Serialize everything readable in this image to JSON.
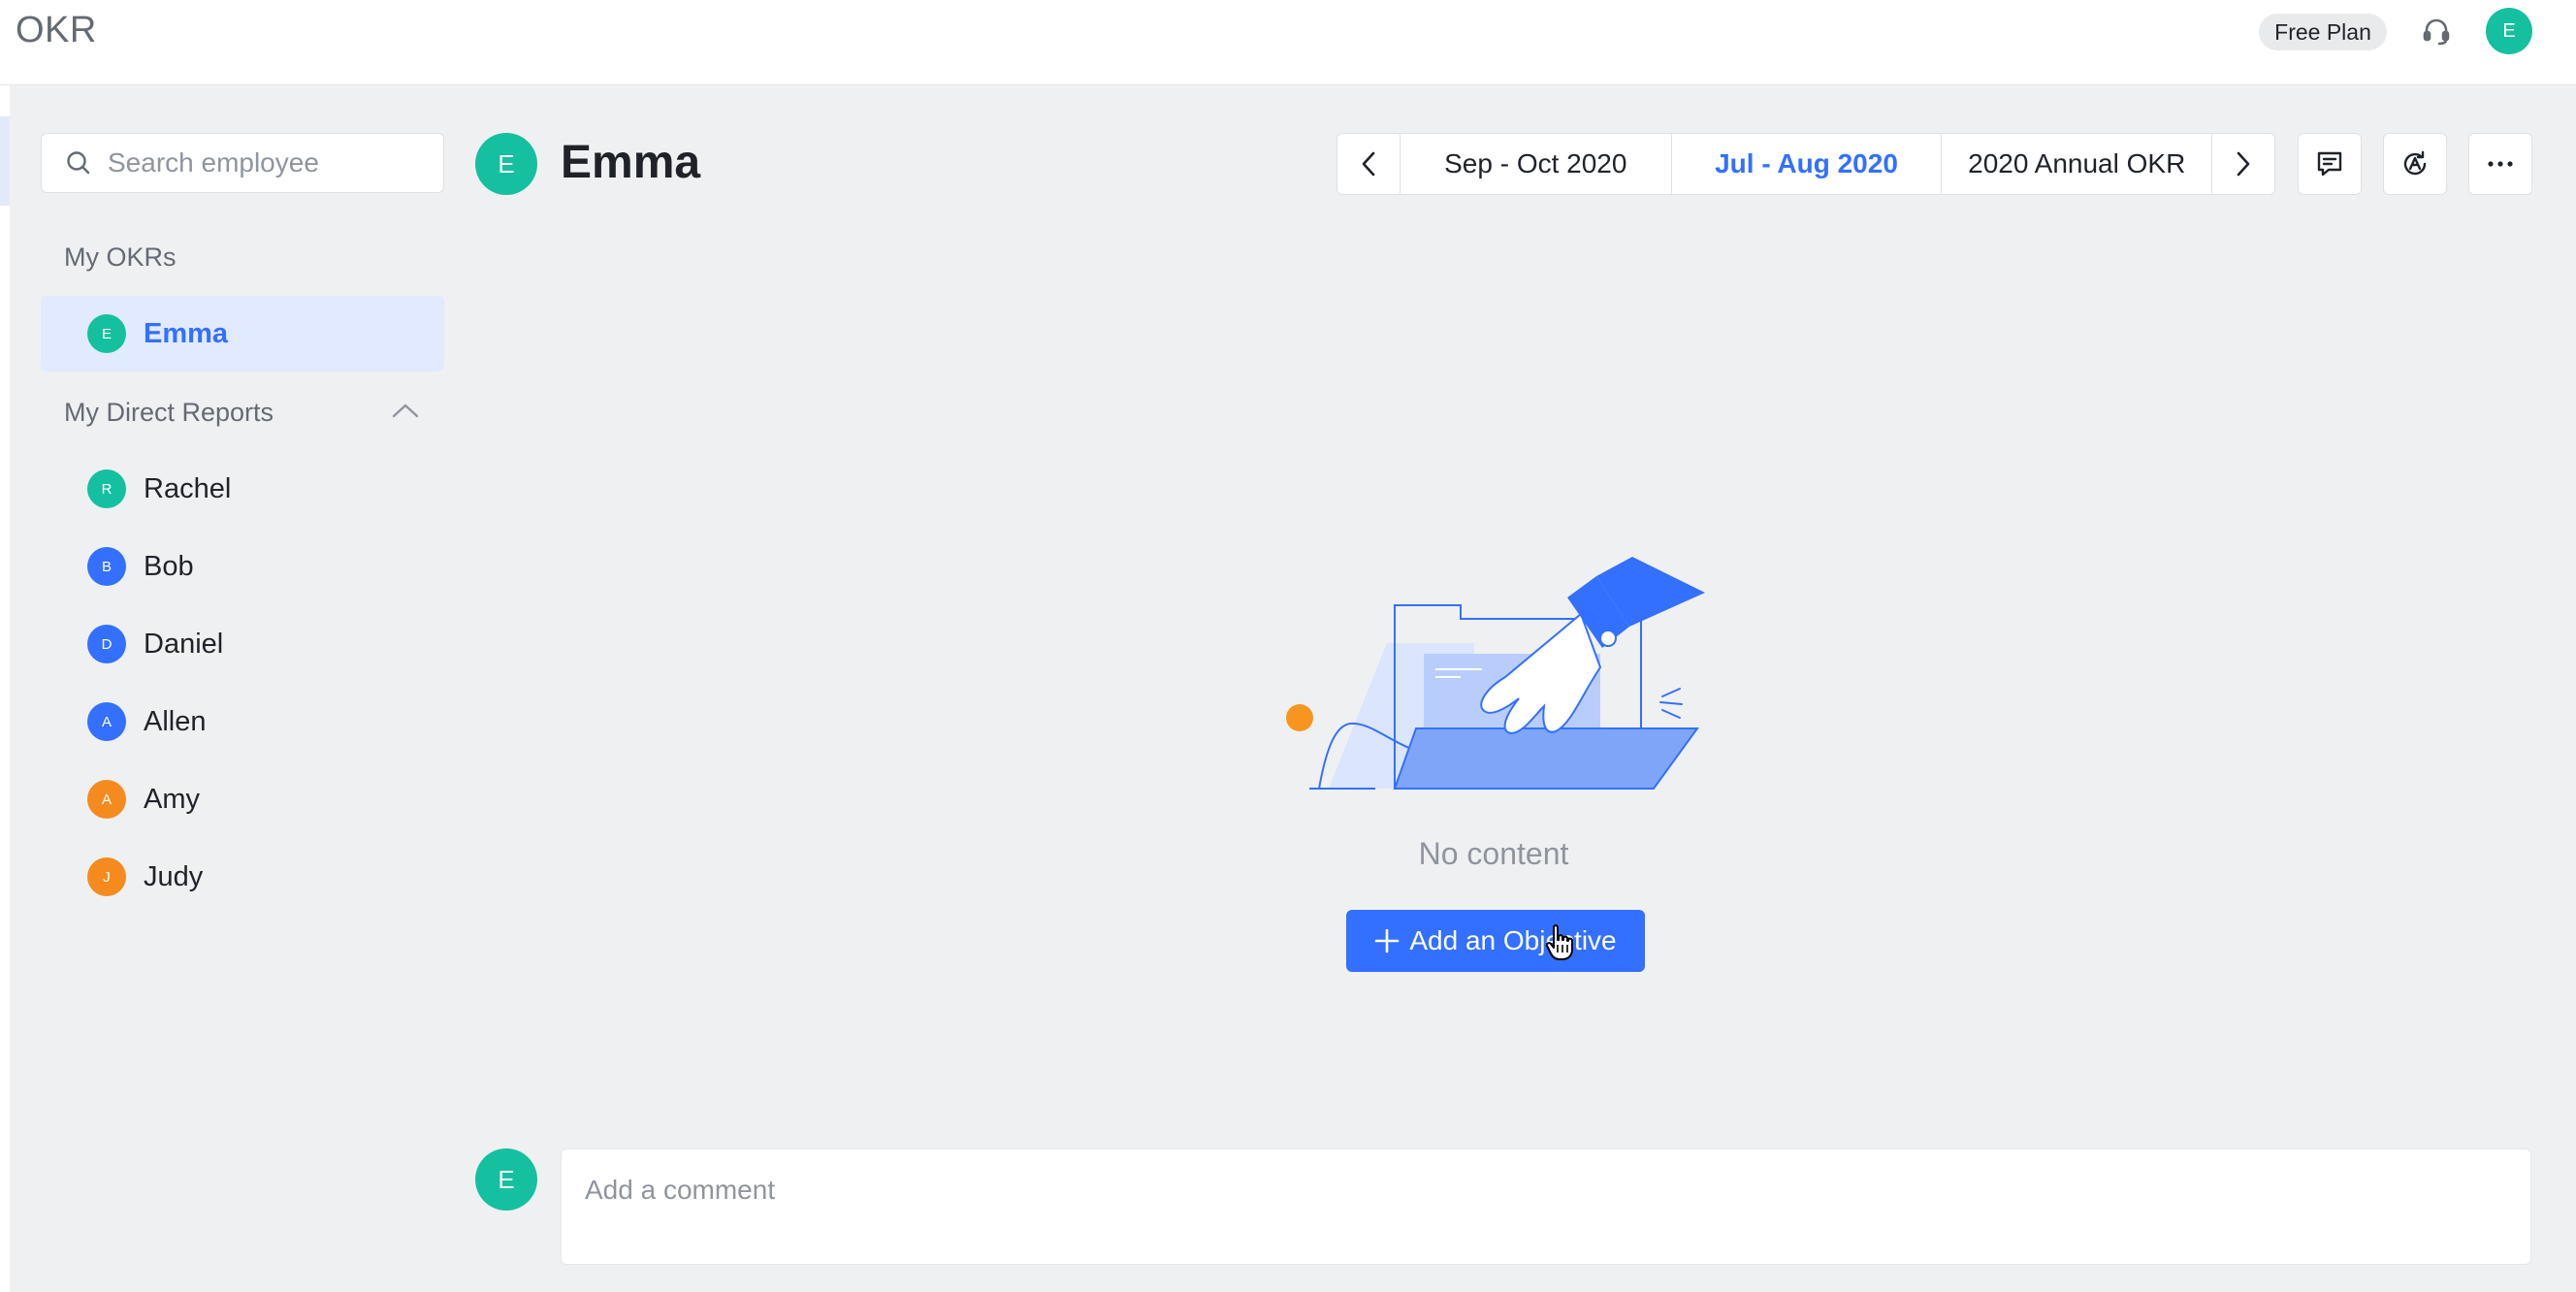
{
  "app": {
    "title": "OKR"
  },
  "header": {
    "plan_badge": "Free Plan",
    "support_icon": "headset-icon",
    "user_initial": "E"
  },
  "sidebar": {
    "search_placeholder": "Search employee",
    "my_okrs_label": "My OKRs",
    "my_okrs": [
      {
        "name": "Emma",
        "initial": "E",
        "color": "#14c0a0",
        "active": true
      }
    ],
    "direct_reports_label": "My Direct Reports",
    "direct_reports": [
      {
        "name": "Rachel",
        "initial": "R",
        "color": "#14c0a0"
      },
      {
        "name": "Bob",
        "initial": "B",
        "color": "#3370ff"
      },
      {
        "name": "Daniel",
        "initial": "D",
        "color": "#3370ff"
      },
      {
        "name": "Allen",
        "initial": "A",
        "color": "#3370ff"
      },
      {
        "name": "Amy",
        "initial": "A",
        "color": "#f58b1f"
      },
      {
        "name": "Judy",
        "initial": "J",
        "color": "#f58b1f"
      }
    ]
  },
  "main": {
    "user_initial": "E",
    "user_name": "Emma",
    "periods": [
      {
        "label": "Sep - Oct 2020",
        "active": false
      },
      {
        "label": "Jul - Aug 2020",
        "active": true
      },
      {
        "label": "2020 Annual OKR",
        "active": false
      }
    ],
    "empty_text": "No content",
    "add_button_label": "Add an Objective"
  },
  "comment": {
    "user_initial": "E",
    "placeholder": "Add a comment"
  },
  "colors": {
    "accent": "#3370ff",
    "teal": "#14c0a0",
    "orange": "#f58b1f"
  }
}
